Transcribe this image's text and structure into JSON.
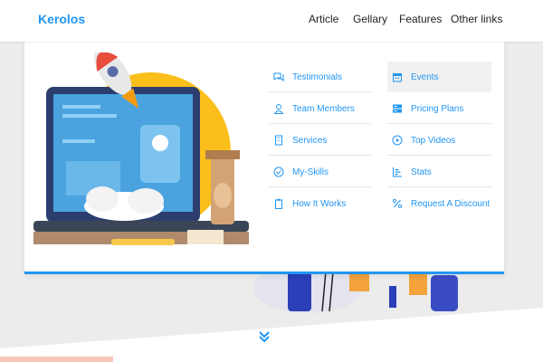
{
  "header": {
    "logo": "Kerolos",
    "nav": [
      {
        "label": "Article"
      },
      {
        "label": "Gellary"
      },
      {
        "label": "Features"
      },
      {
        "label": "Other links"
      }
    ]
  },
  "mega_menu": {
    "left_column": [
      {
        "label": "Testimonials",
        "icon": "comments-icon"
      },
      {
        "label": "Team Members",
        "icon": "user-icon"
      },
      {
        "label": "Services",
        "icon": "building-icon"
      },
      {
        "label": "My-Skills",
        "icon": "check-circle-icon"
      },
      {
        "label": "How It Works",
        "icon": "clipboard-icon"
      }
    ],
    "right_column": [
      {
        "label": "Events",
        "icon": "calendar-icon",
        "active": true
      },
      {
        "label": "Pricing Plans",
        "icon": "server-icon"
      },
      {
        "label": "Top Videos",
        "icon": "play-circle-icon"
      },
      {
        "label": "Stats",
        "icon": "bar-chart-icon"
      },
      {
        "label": "Request A Discount",
        "icon": "percent-icon"
      }
    ]
  },
  "colors": {
    "accent": "#2196f3",
    "illustration_sun": "#fbbf1b"
  }
}
